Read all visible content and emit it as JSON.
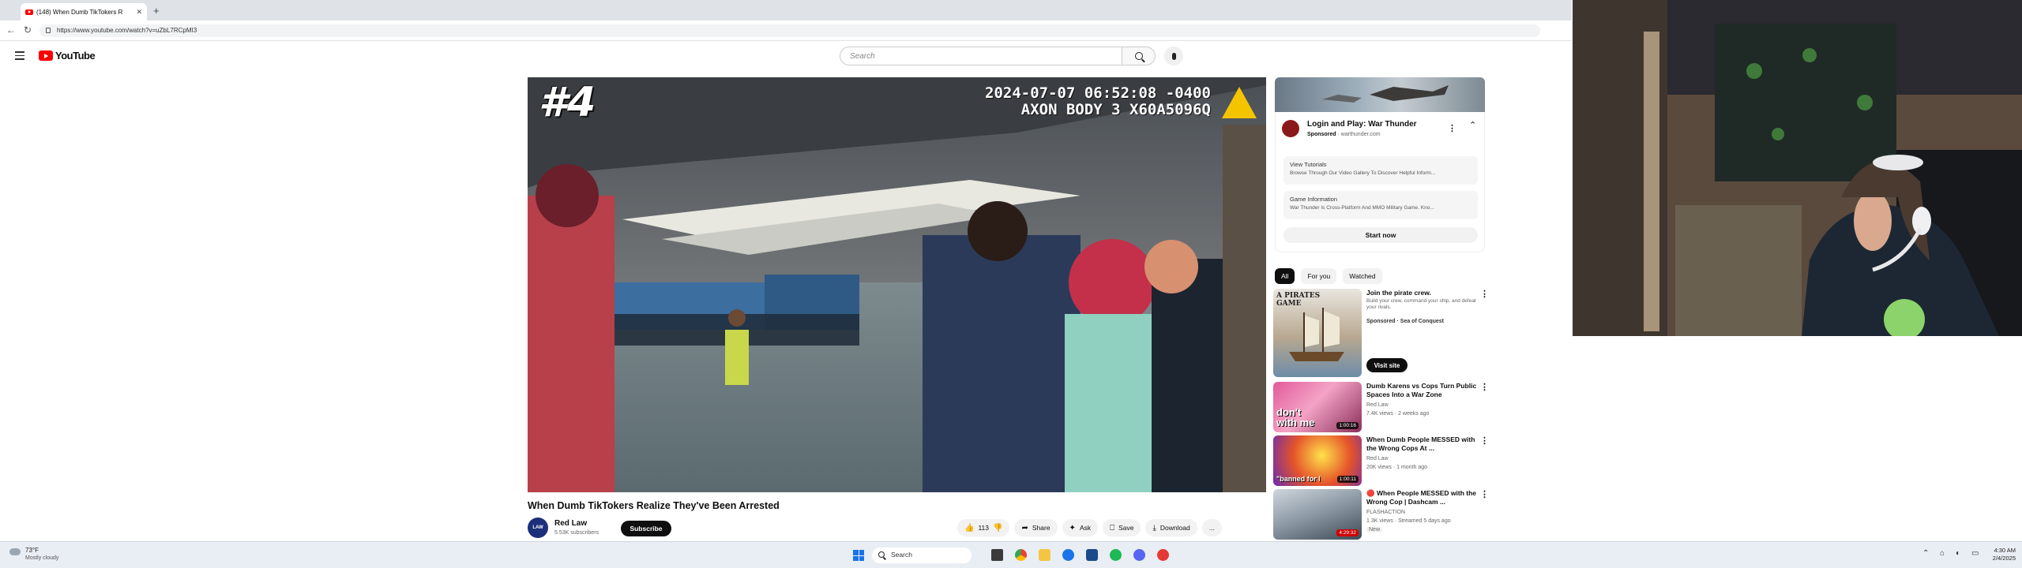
{
  "browser": {
    "tab_title": "(148) When Dumb TikTokers R",
    "tab_close": "✕",
    "new_tab": "+",
    "url": "https://www.youtube.com/watch?v=uZbL7RCpMI3"
  },
  "youtube": {
    "logo_text": "YouTube",
    "search_placeholder": "Search",
    "video": {
      "overlay_number": "#4",
      "timestamp_line1": "2024-07-07 06:52:08 -0400",
      "timestamp_line2": "AXON BODY 3 X60A5096Q",
      "title": "When Dumb TikTokers Realize They've Been Arrested"
    },
    "channel": {
      "avatar_text": "LAW",
      "name": "Red Law",
      "subscribers": "5.53K subscribers",
      "subscribe_label": "Subscribe"
    },
    "actions": {
      "like_count": "113",
      "share": "Share",
      "ask": "Ask",
      "save": "Save",
      "download": "Download",
      "more": "..."
    },
    "ad": {
      "title": "Login and Play: War Thunder",
      "sponsored": "Sponsored",
      "domain": "warthunder.com",
      "rows": [
        {
          "heading": "View Tutorials",
          "desc": "Browse Through Our Video Gallery To Discover Helpful Inform..."
        },
        {
          "heading": "Game Information",
          "desc": "War Thunder Is Cross-Platform And MMO Military Game. Kno..."
        }
      ],
      "cta": "Start now"
    },
    "chips": [
      "All",
      "For you",
      "Watched"
    ],
    "recommendations": [
      {
        "title": "Join the pirate crew.",
        "desc": "Build your crew, command your ship, and defeat your rivals.",
        "channel": "Sponsored · Sea of Conquest",
        "meta": "",
        "cta": "Visit site",
        "thumb_text": "A PIRATES GAME",
        "duration": ""
      },
      {
        "title": "Dumb Karens vs Cops Turn Public Spaces Into a War Zone",
        "channel": "Red Law",
        "meta": "7.4K views · 2 weeks ago",
        "thumb_text": "don't with me",
        "duration": "1:00:16"
      },
      {
        "title": "When Dumb People MESSED with the Wrong Cops At ...",
        "channel": "Red Law",
        "meta": "20K views · 1 month ago",
        "thumb_text": "\"banned for l",
        "duration": "1:00:11"
      },
      {
        "title": "🔴 When People MESSED with the Wrong Cop | Dashcam ...",
        "channel": "FLASHACTION",
        "meta": "1.3K views · Streamed 5 days ago",
        "extra": "New",
        "thumb_text": "",
        "duration": "4:29:32"
      }
    ]
  },
  "taskbar": {
    "weather_temp": "73°F",
    "weather_desc": "Mostly cloudy",
    "search_label": "Search",
    "time": "4:30 AM",
    "date": "2/4/2025"
  },
  "colors": {
    "youtube_red": "#ff0000",
    "accent_blue": "#1a73e8",
    "axon_yellow": "#f5c400"
  }
}
